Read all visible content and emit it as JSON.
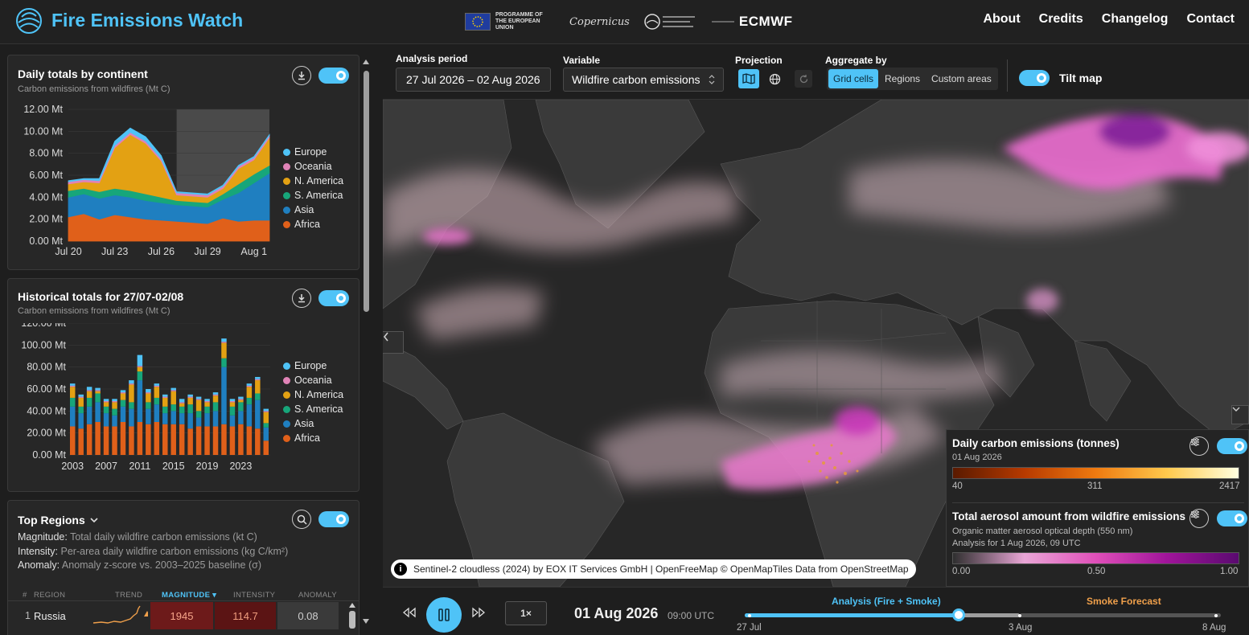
{
  "header": {
    "title": "Fire Emissions Watch",
    "partners": {
      "eu_line1": "PROGRAMME OF",
      "eu_line2": "THE EUROPEAN UNION",
      "copernicus": "Copernicus",
      "ecmwf": "ECMWF"
    },
    "nav": [
      "About",
      "Credits",
      "Changelog",
      "Contact"
    ]
  },
  "daily_card": {
    "title": "Daily totals by continent",
    "subtitle": "Carbon emissions from wildfires (Mt C)",
    "legend": [
      {
        "name": "Europe",
        "color": "#4fc3f7"
      },
      {
        "name": "Oceania",
        "color": "#e083b7"
      },
      {
        "name": "N. America",
        "color": "#e3a113"
      },
      {
        "name": "S. America",
        "color": "#17a67a"
      },
      {
        "name": "Asia",
        "color": "#1f7fc0"
      },
      {
        "name": "Africa",
        "color": "#e0601a"
      }
    ]
  },
  "historical_card": {
    "title": "Historical totals for 27/07-02/08",
    "subtitle": "Carbon emissions from wildfires (Mt C)"
  },
  "top_regions": {
    "title": "Top Regions",
    "magnitude_label": "Magnitude:",
    "magnitude_text": "Total daily wildfire carbon emissions (kt C)",
    "intensity_label": "Intensity:",
    "intensity_text": "Per-area daily wildfire carbon emissions (kg C/km²)",
    "anomaly_label": "Anomaly:",
    "anomaly_text": "Anomaly z-score vs. 2003–2025 baseline (σ)",
    "columns": {
      "num": "#",
      "region": "REGION",
      "trend": "TREND",
      "magnitude": "MAGNITUDE ▾",
      "intensity": "INTENSITY",
      "anomaly": "ANOMALY"
    },
    "rows": [
      {
        "rank": "1",
        "region": "Russia",
        "magnitude": "1945",
        "intensity": "114.7",
        "anomaly": "0.08"
      }
    ]
  },
  "toolbar": {
    "period_label": "Analysis period",
    "period_value": "27 Jul 2026 – 02 Aug 2026",
    "variable_label": "Variable",
    "variable_value": "Wildfire carbon emissions",
    "projection_label": "Projection",
    "aggregate_label": "Aggregate by",
    "aggregate_options": [
      "Grid cells",
      "Regions",
      "Custom areas"
    ],
    "tilt_label": "Tilt map"
  },
  "map": {
    "attribution_1": "Sentinel-2 cloudless (2024) by EOX IT Services GmbH | OpenFreeMap ©",
    "attribution_2": "OpenMapTiles",
    "attribution_3": "Data from",
    "attribution_4": "OpenStreetMap"
  },
  "legend_panel": {
    "emissions_title": "Daily carbon emissions (tonnes)",
    "emissions_date": "01 Aug 2026",
    "emissions_ticks": [
      "40",
      "311",
      "2417"
    ],
    "aerosol_title": "Total aerosol amount from wildfire emissions",
    "aerosol_sub1": "Organic matter aerosol optical depth (550 nm)",
    "aerosol_sub2": "Analysis for 1 Aug 2026, 09 UTC",
    "aerosol_ticks": [
      "0.00",
      "0.50",
      "1.00"
    ]
  },
  "timeline": {
    "speed": "1×",
    "date": "01 Aug 2026",
    "time": "09:00 UTC",
    "analysis_label": "Analysis (Fire + Smoke)",
    "forecast_label": "Smoke Forecast",
    "ticks": [
      "27 Jul",
      "3 Aug",
      "8 Aug"
    ],
    "position_fraction": 0.45
  },
  "colors": {
    "accent": "#4fc3f7",
    "forecast": "#f0a04b"
  },
  "chart_data": [
    {
      "type": "area",
      "title": "Daily totals by continent",
      "subtitle": "Carbon emissions from wildfires (Mt C)",
      "x": [
        "Jul 20",
        "Jul 21",
        "Jul 22",
        "Jul 23",
        "Jul 24",
        "Jul 25",
        "Jul 26",
        "Jul 27",
        "Jul 28",
        "Jul 29",
        "Jul 30",
        "Jul 31",
        "Aug 1",
        "Aug 2"
      ],
      "xticks": [
        "Jul 20",
        "Jul 23",
        "Jul 26",
        "Jul 29",
        "Aug 1"
      ],
      "yticks": [
        "0.00 Mt",
        "2.00 Mt",
        "4.00 Mt",
        "6.00 Mt",
        "8.00 Mt",
        "10.00 Mt",
        "12.00 Mt"
      ],
      "ylim": [
        0,
        12
      ],
      "highlight_range": [
        "Jul 27",
        "Aug 2"
      ],
      "series": [
        {
          "name": "Africa",
          "values": [
            2.2,
            2.5,
            2.0,
            2.4,
            2.2,
            2.0,
            1.9,
            1.8,
            1.7,
            1.6,
            2.1,
            1.8,
            1.9,
            1.9
          ]
        },
        {
          "name": "Asia",
          "values": [
            1.8,
            1.8,
            1.9,
            1.8,
            1.8,
            1.7,
            1.6,
            1.5,
            1.5,
            1.5,
            1.7,
            2.6,
            3.4,
            4.3
          ]
        },
        {
          "name": "S. America",
          "values": [
            0.6,
            0.5,
            0.6,
            0.6,
            0.6,
            0.6,
            0.5,
            0.4,
            0.4,
            0.4,
            0.5,
            0.8,
            0.8,
            0.7
          ]
        },
        {
          "name": "N. America",
          "values": [
            0.6,
            0.6,
            0.8,
            3.7,
            5.1,
            4.6,
            3.3,
            0.5,
            0.5,
            0.5,
            0.5,
            1.4,
            1.3,
            2.5
          ]
        },
        {
          "name": "Oceania",
          "values": [
            0.2,
            0.2,
            0.2,
            0.2,
            0.2,
            0.2,
            0.2,
            0.2,
            0.2,
            0.2,
            0.2,
            0.2,
            0.2,
            0.2
          ]
        },
        {
          "name": "Europe",
          "values": [
            0.1,
            0.1,
            0.2,
            0.4,
            0.4,
            0.4,
            0.3,
            0.1,
            0.1,
            0.1,
            0.1,
            0.1,
            0.1,
            0.1
          ]
        }
      ]
    },
    {
      "type": "bar",
      "title": "Historical totals for 27/07-02/08",
      "subtitle": "Carbon emissions from wildfires (Mt C)",
      "categories": [
        "2003",
        "2004",
        "2005",
        "2006",
        "2007",
        "2008",
        "2009",
        "2010",
        "2011",
        "2012",
        "2013",
        "2014",
        "2015",
        "2016",
        "2017",
        "2018",
        "2019",
        "2020",
        "2021",
        "2022",
        "2023",
        "2024",
        "2025",
        "2026"
      ],
      "xticks": [
        "2003",
        "2007",
        "2011",
        "2015",
        "2019",
        "2023"
      ],
      "yticks": [
        "0.00 Mt",
        "20.00 Mt",
        "40.00 Mt",
        "60.00 Mt",
        "80.00 Mt",
        "100.00 Mt",
        "120.00 Mt"
      ],
      "ylim": [
        0,
        120
      ],
      "series": [
        {
          "name": "Africa",
          "values": [
            26,
            24,
            28,
            30,
            26,
            26,
            30,
            26,
            30,
            28,
            30,
            28,
            28,
            28,
            24,
            26,
            26,
            26,
            28,
            26,
            28,
            26,
            24,
            13
          ]
        },
        {
          "name": "Asia",
          "values": [
            18,
            14,
            16,
            18,
            12,
            10,
            14,
            16,
            38,
            14,
            16,
            10,
            12,
            10,
            14,
            8,
            12,
            14,
            52,
            10,
            12,
            20,
            26,
            12
          ]
        },
        {
          "name": "S. America",
          "values": [
            8,
            6,
            8,
            8,
            6,
            6,
            6,
            6,
            8,
            6,
            6,
            6,
            6,
            6,
            8,
            6,
            6,
            8,
            8,
            8,
            8,
            6,
            6,
            4
          ]
        },
        {
          "name": "N. America",
          "values": [
            10,
            8,
            6,
            2,
            4,
            6,
            6,
            16,
            4,
            8,
            10,
            8,
            12,
            3,
            6,
            10,
            4,
            6,
            14,
            4,
            2,
            10,
            12,
            10
          ]
        },
        {
          "name": "Oceania",
          "values": [
            1,
            1,
            1,
            1,
            1,
            1,
            1,
            1,
            1,
            1,
            1,
            1,
            1,
            1,
            1,
            1,
            1,
            1,
            1,
            1,
            1,
            1,
            1,
            1
          ]
        },
        {
          "name": "Europe",
          "values": [
            2,
            2,
            3,
            2,
            2,
            2,
            2,
            3,
            10,
            3,
            2,
            2,
            2,
            3,
            2,
            2,
            2,
            2,
            3,
            2,
            2,
            2,
            2,
            2
          ]
        }
      ]
    }
  ]
}
